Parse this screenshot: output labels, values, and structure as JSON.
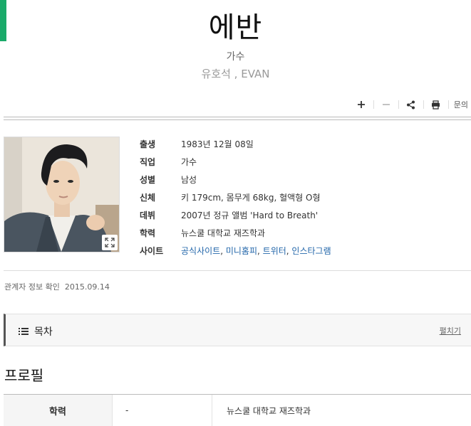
{
  "header": {
    "name": "에반",
    "occupation": "가수",
    "alias": "유호석 , EVAN"
  },
  "toolbar": {
    "zoom_in_icon": "plus-icon",
    "zoom_out_icon": "minus-icon",
    "share_icon": "share-icon",
    "print_icon": "print-icon",
    "inquiry_label": "문의"
  },
  "info": {
    "rows": [
      {
        "label": "출생",
        "value": "1983년 12월 08일"
      },
      {
        "label": "직업",
        "value": "가수"
      },
      {
        "label": "성별",
        "value": "남성"
      },
      {
        "label": "신체",
        "value": "키 179cm, 몸무게 68kg, 혈액형 O형"
      },
      {
        "label": "데뷔",
        "value": "2007년 정규 앨범 'Hard to Breath'"
      },
      {
        "label": "학력",
        "value": "뉴스쿨 대학교 재즈학과"
      }
    ],
    "site_label": "사이트",
    "site_links": [
      "공식사이트",
      "미니홈피",
      "트위터",
      "인스타그램"
    ],
    "site_separator": ", "
  },
  "verification": {
    "label": "관계자 정보 확인",
    "date": "2015.09.14"
  },
  "toc": {
    "title": "목차",
    "toggle_label": "펼치기"
  },
  "profile": {
    "heading": "프로필",
    "table": [
      {
        "label": "학력",
        "period": "-",
        "value": "뉴스쿨 대학교 재즈학과"
      }
    ]
  }
}
